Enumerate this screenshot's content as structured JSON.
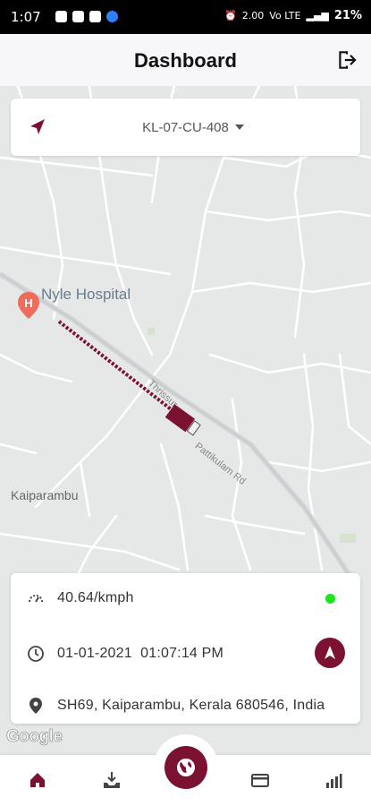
{
  "status_bar": {
    "time": "1:07",
    "speed": "2.00",
    "signal_label": "Vo LTE",
    "battery": "21%"
  },
  "header": {
    "title": "Dashboard"
  },
  "vehicle": {
    "plate": "KL-07-CU-408"
  },
  "map": {
    "places": {
      "hospital": "Nyle Hospital",
      "locality": "Kaiparambu"
    },
    "roads": {
      "road_a": "Thrissur",
      "road_b": "Pattikulam Rd"
    },
    "attribution": "Google"
  },
  "info": {
    "speed": "40.64/kmph",
    "date": "01-01-2021",
    "time": "01:07:14 PM",
    "address": "SH69, Kaiparambu, Kerala 680546, India"
  },
  "colors": {
    "accent": "#7b1232",
    "online": "#1de51d"
  }
}
